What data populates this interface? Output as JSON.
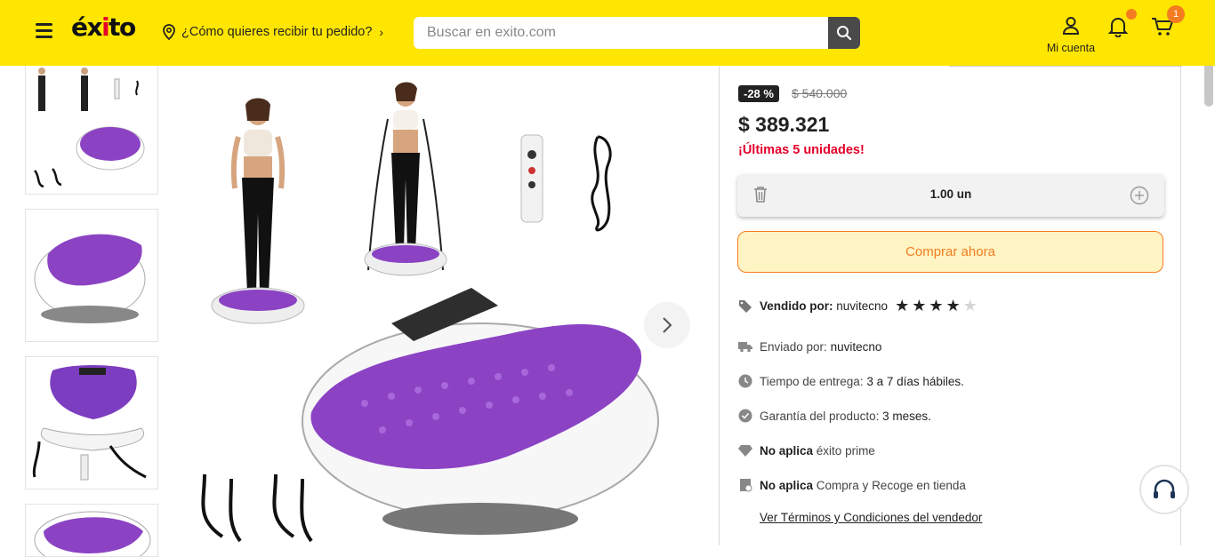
{
  "header": {
    "logo": "éxito",
    "location_prompt": "¿Cómo quieres recibir tu pedido?",
    "search_placeholder": "Buscar en exito.com",
    "account_label": "Mi cuenta",
    "cart_count": "1",
    "accent_color": "#ffe600",
    "badge_color": "#f47c20"
  },
  "gallery": {
    "thumbnails": [
      "thumb-1",
      "thumb-2",
      "thumb-3",
      "thumb-4"
    ]
  },
  "product": {
    "discount": "-28 %",
    "old_price": "$ 540.000",
    "price": "$ 389.321",
    "stock_notice": "¡Últimas 5 unidades!",
    "quantity": "1.00 un",
    "buy_button": "Comprar ahora",
    "seller_label": "Vendido por:",
    "seller_name": "nuvitecno",
    "seller_rating": 4,
    "shipped_label": "Enviado por:",
    "shipped_by": "nuvitecno",
    "delivery_label": "Tiempo de entrega:",
    "delivery_value": "3 a 7 días hábiles.",
    "warranty_label": "Garantía del producto:",
    "warranty_value": "3 meses.",
    "prime_bold": "No aplica",
    "prime_text": "éxito prime",
    "pickup_bold": "No aplica",
    "pickup_text": "Compra y Recoge en tienda",
    "terms_link": "Ver Términos y Condiciones del vendedor"
  }
}
